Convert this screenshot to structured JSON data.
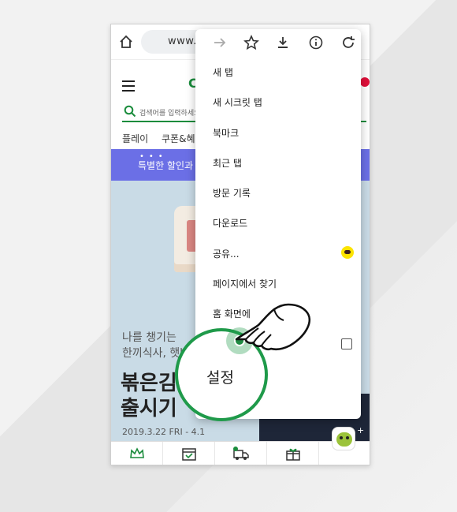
{
  "browser": {
    "url": "www.c",
    "menu_icons": [
      "forward-arrow-icon",
      "star-icon",
      "download-icon",
      "info-icon",
      "refresh-icon"
    ],
    "menu_items": [
      {
        "label": "새 탭"
      },
      {
        "label": "새 시크릿 탭"
      },
      {
        "label": "북마크"
      },
      {
        "label": "최근 탭"
      },
      {
        "label": "방문 기록"
      },
      {
        "label": "다운로드"
      },
      {
        "label": "공유..."
      },
      {
        "label": "페이지에서 찾기"
      },
      {
        "label": "홈 화면에"
      }
    ]
  },
  "site": {
    "logo_fragment": "C",
    "search_placeholder": "검색어를 입력하세요",
    "categories": [
      "플레이",
      "쿠폰&혜택"
    ],
    "promo_text": "특별한 할인과 혜",
    "hero": {
      "line1": "나를 챙기는",
      "line2": "한끼식사, 햇반컵",
      "title1": "볶은김",
      "title2": "출시기",
      "date": "2019.3.22 FRI - 4.1",
      "plus": "+"
    },
    "bottom_nav": [
      "crown-icon",
      "calendar-check-icon",
      "truck-icon",
      "gift-icon",
      "mascot-icon"
    ]
  },
  "magnifier": {
    "label": "설정"
  },
  "colors": {
    "accent_green": "#1f9a4a",
    "promo_purple": "#6b6fe6",
    "kakao_yellow": "#fce300"
  }
}
